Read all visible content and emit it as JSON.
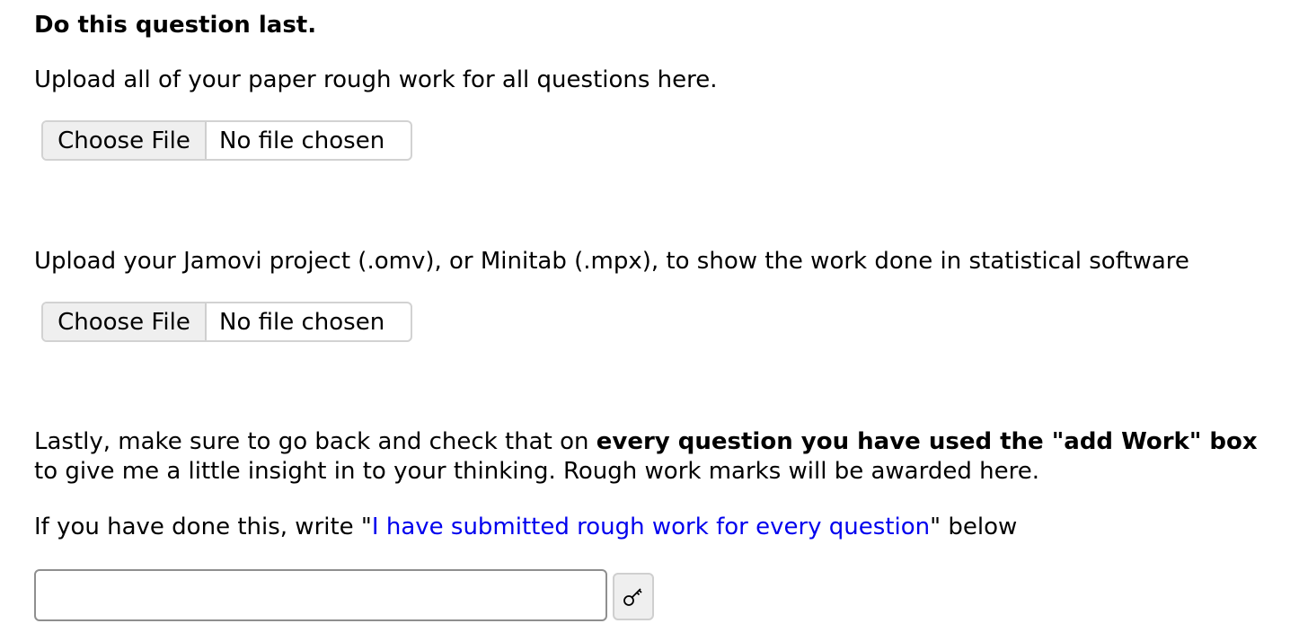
{
  "intro": {
    "heading": "Do this question last.",
    "upload_rough_work_prompt": "Upload all of your paper rough work for all questions here."
  },
  "upload_rough_work": {
    "button_label": "Choose File",
    "status": "No file chosen"
  },
  "software_prompt": "Upload your Jamovi project (.omv), or Minitab (.mpx), to show the work done in statistical software",
  "upload_software": {
    "button_label": "Choose File",
    "status": "No file chosen"
  },
  "final_check": {
    "text_before": "Lastly, make sure to go back and check that on ",
    "text_bold": "every question you have used the \"add Work\" box",
    "text_after": " to give me a little insight in to your thinking. Rough work marks will be awarded here."
  },
  "instruction": {
    "text_before": "If you have done this, write \"",
    "highlight": "I have submitted rough work for every question",
    "text_after": "\" below"
  },
  "answer": {
    "value": "",
    "placeholder": ""
  },
  "icons": {
    "key_button": "key-icon"
  }
}
